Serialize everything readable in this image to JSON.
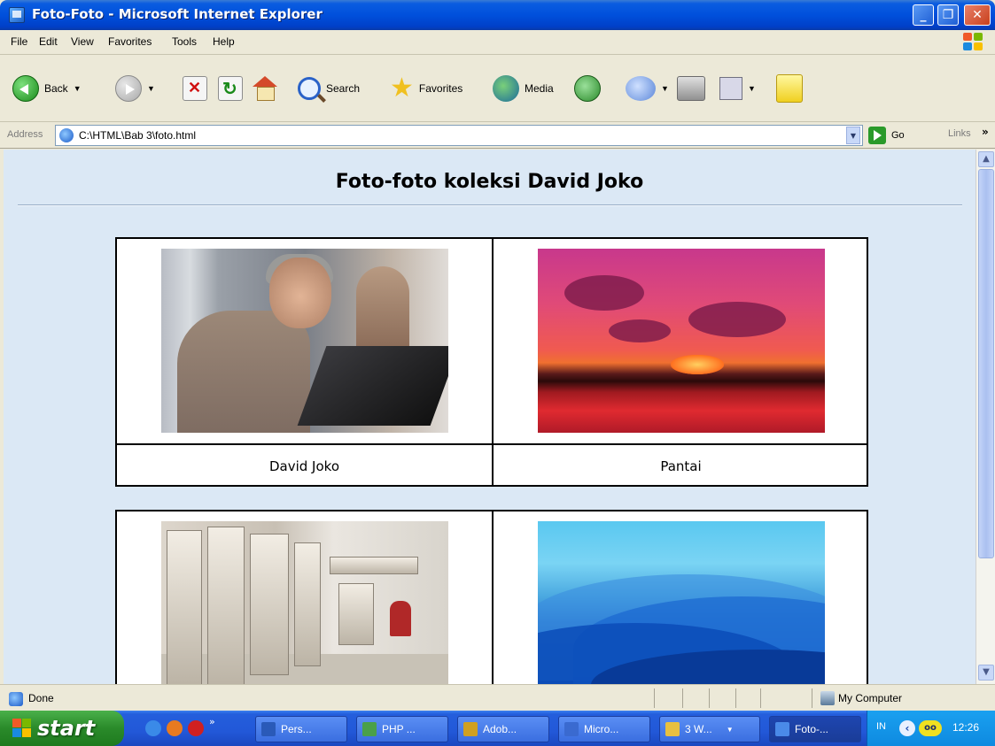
{
  "window": {
    "title": "Foto-Foto - Microsoft Internet Explorer",
    "minimize_icon": "minimize-icon",
    "maximize_icon": "restore-icon",
    "close_icon": "close-icon"
  },
  "menu": {
    "items": [
      "File",
      "Edit",
      "View",
      "Favorites",
      "Tools",
      "Help"
    ]
  },
  "toolbar": {
    "back_label": "Back",
    "search_label": "Search",
    "favorites_label": "Favorites",
    "media_label": "Media"
  },
  "address": {
    "label": "Address",
    "value": "C:\\HTML\\Bab 3\\foto.html",
    "go_label": "Go",
    "links_label": "Links",
    "links_chevron": "»"
  },
  "page": {
    "title": "Foto-foto koleksi David Joko",
    "photos": [
      {
        "caption": "David Joko",
        "subject": "man-with-laptop"
      },
      {
        "caption": "Pantai",
        "subject": "sunset-beach"
      },
      {
        "caption": "",
        "subject": "server-room"
      },
      {
        "caption": "",
        "subject": "blue-mountains"
      }
    ]
  },
  "status": {
    "left": "Done",
    "zone": "My Computer"
  },
  "taskbar": {
    "start_label": "start",
    "tasks": [
      {
        "label": "Pers...",
        "icon": "word-icon",
        "color": "#2a5ab8"
      },
      {
        "label": "PHP ...",
        "icon": "folder-php-icon",
        "color": "#4aa04a"
      },
      {
        "label": "Adob...",
        "icon": "adobe-icon",
        "color": "#d0a020"
      },
      {
        "label": "Micro...",
        "icon": "msoffice-icon",
        "color": "#3a6ad0"
      },
      {
        "label": "3 W...",
        "icon": "folder-icon",
        "color": "#e8c040"
      },
      {
        "label": "Foto-...",
        "icon": "ie-icon",
        "color": "#4a8ae8"
      }
    ],
    "tray": {
      "language": "IN",
      "clock": "12:26"
    }
  },
  "colors": {
    "titlebar": "#0050dc",
    "page_background": "#dbe8f5",
    "table_border": "#000000",
    "taskbar": "#2258d8",
    "start_button": "#2a8a2a"
  }
}
